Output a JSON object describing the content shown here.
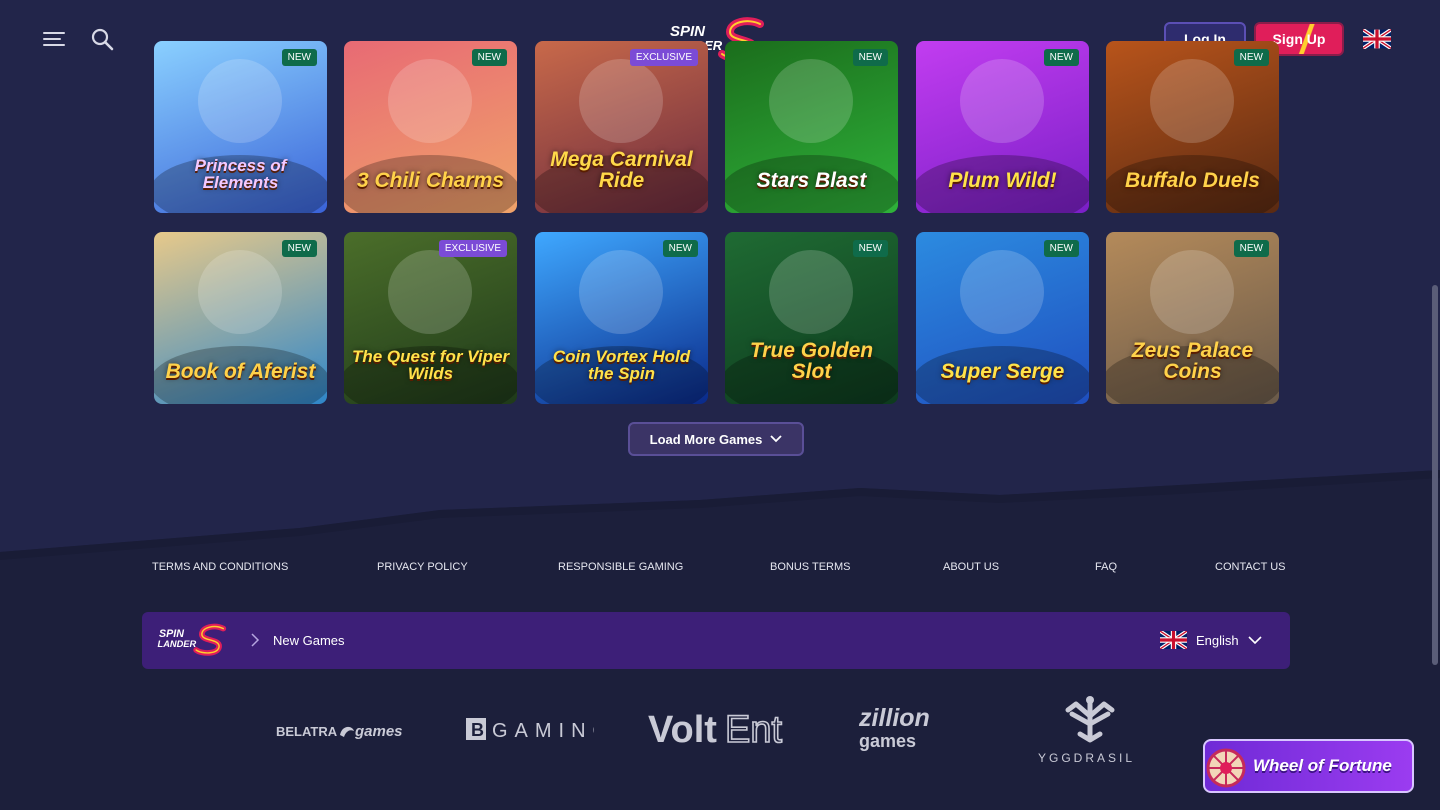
{
  "header": {
    "menu_icon": "hamburger-menu-icon",
    "search_icon": "search-icon",
    "logo_line1": "SPIN",
    "logo_line2": "LANDER",
    "login_label": "Log In",
    "signup_label": "Sign Up",
    "language_flag": "uk-flag-icon"
  },
  "games": [
    {
      "title": "Princess of Elements",
      "badge": "NEW",
      "badge_type": "new",
      "bg1": "#3a63d8",
      "bg2": "#8ad0ff",
      "title_color": "#f4c9ff"
    },
    {
      "title": "3 Chili Charms",
      "badge": "NEW",
      "badge_type": "new",
      "bg1": "#f0a36a",
      "bg2": "#e86a74",
      "title_color": "#ffd24a"
    },
    {
      "title": "Mega Carnival Ride",
      "badge": "EXCLUSIVE",
      "badge_type": "exclusive",
      "bg1": "#6b2b3e",
      "bg2": "#c8694a",
      "title_color": "#ffd94a"
    },
    {
      "title": "Stars Blast",
      "badge": "NEW",
      "badge_type": "new",
      "bg1": "#2fb23a",
      "bg2": "#1b6d1c",
      "title_color": "#ffffff"
    },
    {
      "title": "Plum Wild!",
      "badge": "NEW",
      "badge_type": "new",
      "bg1": "#7a1fc7",
      "bg2": "#c23df0",
      "title_color": "#ffe24a"
    },
    {
      "title": "Buffalo Duels",
      "badge": "NEW",
      "badge_type": "new",
      "bg1": "#5a2a12",
      "bg2": "#b8541b",
      "title_color": "#ffd24a"
    },
    {
      "title": "Book of Aferist",
      "badge": "NEW",
      "badge_type": "new",
      "bg1": "#2f86c9",
      "bg2": "#e7c98a",
      "title_color": "#ffd24a"
    },
    {
      "title": "The Quest for Viper Wilds",
      "badge": "EXCLUSIVE",
      "badge_type": "exclusive",
      "bg1": "#1f3a1a",
      "bg2": "#4b6e2a",
      "title_color": "#ffe24a"
    },
    {
      "title": "Coin Vortex Hold the Spin",
      "badge": "NEW",
      "badge_type": "new",
      "bg1": "#0a2a8a",
      "bg2": "#3fa8ff",
      "title_color": "#ffe24a"
    },
    {
      "title": "True Golden Slot",
      "badge": "NEW",
      "badge_type": "new",
      "bg1": "#0d3a1e",
      "bg2": "#1f6b33",
      "title_color": "#ffd24a"
    },
    {
      "title": "Super Serge",
      "badge": "NEW",
      "badge_type": "new",
      "bg1": "#1f4fbf",
      "bg2": "#2c8be0",
      "title_color": "#ffe24a"
    },
    {
      "title": "Zeus Palace Coins",
      "badge": "NEW",
      "badge_type": "new",
      "bg1": "#6a5a4a",
      "bg2": "#b48a5a",
      "title_color": "#ffd24a"
    }
  ],
  "load_more_label": "Load More Games",
  "footer_links": [
    "TERMS AND CONDITIONS",
    "PRIVACY POLICY",
    "RESPONSIBLE GAMING",
    "BONUS TERMS",
    "ABOUT US",
    "FAQ",
    "CONTACT US"
  ],
  "footer_bar": {
    "breadcrumb": "New Games",
    "language": "English"
  },
  "providers": [
    "BELATRA games",
    "BGAMING",
    "VoltEnt",
    "zillion games",
    "YGGDRASIL"
  ],
  "wheel_of_fortune_label": "Wheel of Fortune",
  "colors": {
    "background": "#1c1f3b",
    "accent_purple": "#3d1f78",
    "signup_red": "#e01e5a",
    "new_badge": "#0f6b4a",
    "exclusive_badge": "#7b4bd6"
  }
}
